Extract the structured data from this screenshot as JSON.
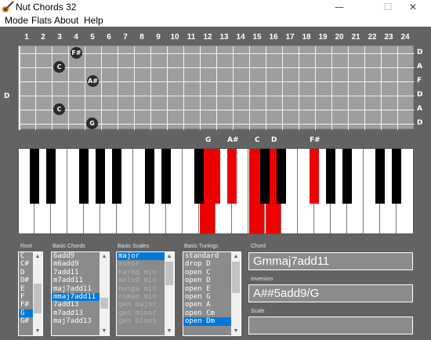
{
  "window": {
    "title": "Nut Chords 32",
    "minimize_glyph": "—",
    "maximize_glyph": "☐",
    "close_glyph": "✕"
  },
  "menu": [
    "Mode",
    "Flats",
    "About",
    "Help"
  ],
  "fretboard": {
    "fret_numbers": [
      "1",
      "2",
      "3",
      "4",
      "5",
      "6",
      "7",
      "8",
      "9",
      "10",
      "11",
      "12",
      "13",
      "14",
      "15",
      "16",
      "17",
      "18",
      "19",
      "20",
      "21",
      "22",
      "23",
      "24"
    ],
    "string_names": [
      "D",
      "A",
      "F",
      "D",
      "A",
      "D"
    ],
    "tuning_root": "D",
    "notes": [
      "F#",
      "C",
      "A#",
      "C",
      "G"
    ]
  },
  "piano": {
    "labels": [
      "G",
      "A#",
      "C",
      "D",
      "F#"
    ],
    "accent": "#ee0000"
  },
  "panels": {
    "root": {
      "label": "Root",
      "items": [
        "C",
        "C#",
        "D",
        "D#",
        "E",
        "F",
        "F#",
        "G",
        "G#"
      ],
      "selected": "G"
    },
    "chords": {
      "label": "Basic Chords",
      "items": [
        "6add9",
        "m6add9",
        "7add11",
        "m7add11",
        "maj7add11",
        "mmaj7add11",
        "7add13",
        "m7add13",
        "maj7add13"
      ],
      "selected": "mmaj7add11"
    },
    "scales": {
      "label": "Basic Scales",
      "items": [
        "major",
        "minor",
        "harmo min",
        "melod min",
        "hunga min",
        "roman min",
        "gen major",
        "gen minor",
        "gen blues"
      ],
      "selected": "major"
    },
    "tunings": {
      "label": "Basic Tunings",
      "items": [
        "standard",
        "drop D",
        "open C",
        "open D",
        "open E",
        "open G",
        "open A",
        "open Cm",
        "open Dm"
      ],
      "selected": "open Dm"
    }
  },
  "fields": {
    "chord_label": "Chord",
    "chord_value": "Gmmaj7add11",
    "inversion_label": "Inversion",
    "inversion_value": "A##5add9/G",
    "scale_label": "Scale",
    "scale_value": ""
  },
  "colors": {
    "background": "#636363",
    "highlight": "#ee0000",
    "selection": "#0078d7"
  }
}
